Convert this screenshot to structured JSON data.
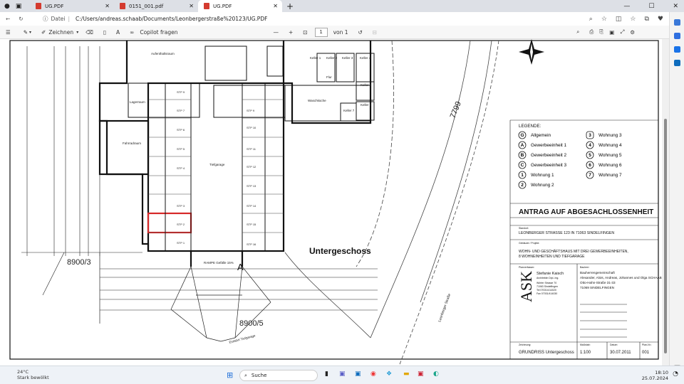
{
  "tabs": [
    {
      "label": "UG.PDF",
      "active": false
    },
    {
      "label": "0151_001.pdf",
      "active": false
    },
    {
      "label": "UG.PDF",
      "active": true
    }
  ],
  "address": {
    "label": "Datei",
    "path": "C:/Users/andreas.schaab/Documents/Leonbergerstraße%20123/UG.PDF"
  },
  "pdf_toolbar": {
    "draw_label": "Zeichnen",
    "copilot_label": "Copilot fragen",
    "page_current": "1",
    "page_total": "von 1"
  },
  "plan": {
    "floor_label": "Untergeschoss",
    "dim_a": "8900/3",
    "dim_b": "8900/5",
    "section_mark": "A",
    "tag_7799": "7799",
    "street": "Leonberger Straße",
    "rooms": {
      "aufenthalt": "Aufenthaltsraum",
      "lager": "Lagerraum",
      "fahrrad": "Fahrradraum",
      "tiefgarage": "Tiefgarage",
      "flur": "Flur",
      "waschkueche": "Waschküche",
      "keller1": "Keller 1",
      "keller2": "Keller 2",
      "keller3": "Keller 3",
      "keller4": "Keller 4",
      "keller5": "Keller 5",
      "keller6": "Keller 6",
      "keller7": "Keller 7",
      "rampe": "RAMPE Gefälle 15%",
      "einfahrt": "Einfahrt Tiefgarage"
    },
    "stp_left": [
      "STP 9",
      "STP 7",
      "STP 6",
      "STP 5",
      "STP 4",
      "STP 3",
      "STP 2",
      "STP 1"
    ],
    "stp_right": [
      "STP 9",
      "STP 10",
      "STP 11",
      "STP 12",
      "STP 13",
      "STP 14",
      "STP 15",
      "STP 16"
    ]
  },
  "legend": {
    "title": "LEGENDE:",
    "items": [
      {
        "symbol": "G",
        "shape": "circle",
        "text": "Allgemein"
      },
      {
        "symbol": "A",
        "shape": "circle",
        "text": "Gewerbeeinheit 1"
      },
      {
        "symbol": "B",
        "shape": "circle",
        "text": "Gewerbeeinheit 2"
      },
      {
        "symbol": "C",
        "shape": "circle",
        "text": "Gewerbeeinheit 3"
      },
      {
        "symbol": "1",
        "shape": "circle",
        "text": "Wohnung 1"
      },
      {
        "symbol": "2",
        "shape": "circle",
        "text": "Wohnung 2"
      },
      {
        "symbol": "3",
        "shape": "square",
        "text": "Wohnung 3"
      },
      {
        "symbol": "4",
        "shape": "circle",
        "text": "Wohnung 4"
      },
      {
        "symbol": "5",
        "shape": "circle",
        "text": "Wohnung 5"
      },
      {
        "symbol": "6",
        "shape": "circle",
        "text": "Wohnung 6"
      },
      {
        "symbol": "7",
        "shape": "circle",
        "text": "Wohnung 7"
      }
    ]
  },
  "titleblock": {
    "heading": "ANTRAG AUF ABGESACHLOSSENHEIT",
    "standort_label": "Standort:",
    "standort": "LEONBERGER STRASSE 123 IN 71063 SINDELFINGEN",
    "gebaeude_label": "Gebäude / Projekt:",
    "gebaeude_1": "WOHN- UND GESCHÄFTSHAUS MIT DREI GEWERBEEINHEITEN,",
    "gebaeude_2": "8 WOHNEINHEITEN UND TIEFGARAGE",
    "planverfasser_label": "Planverfasser:",
    "architect": "Stefanie Kaisch",
    "architect_sub": "Architektin Dipl.-Ing.",
    "architect_addr1": "Wörter Strasse 70",
    "architect_addr2": "71063 Sindelfingen",
    "architect_tel": "Tel 07031/414020",
    "architect_fax": "Fax 07031/414030",
    "bauherr_label": "Bauherr:",
    "bauherr_1": "Bauherrengemeinschaft",
    "bauherr_2": "Alexander, Alois, Andreas, Johannes und Olga SCHAAB",
    "bauherr_3": "Otto-Hahn-Straße 31-33",
    "bauherr_4": "71069 SINDELFINGEN",
    "ask": "ASK",
    "col_zeichnung": "Zeichnung:",
    "col_massstab": "Maßstab:",
    "col_datum": "Datum:",
    "col_planenr": "Plan-Nr.:",
    "zeichnung": "GRUNDRISS Untergeschoss",
    "massstab": "1:100",
    "datum": "30.07.2011",
    "planenr": "001"
  },
  "taskbar": {
    "temp": "24°C",
    "weather": "Stark bewölkt",
    "search": "Suche",
    "time": "18:10",
    "date": "25.07.2024"
  }
}
